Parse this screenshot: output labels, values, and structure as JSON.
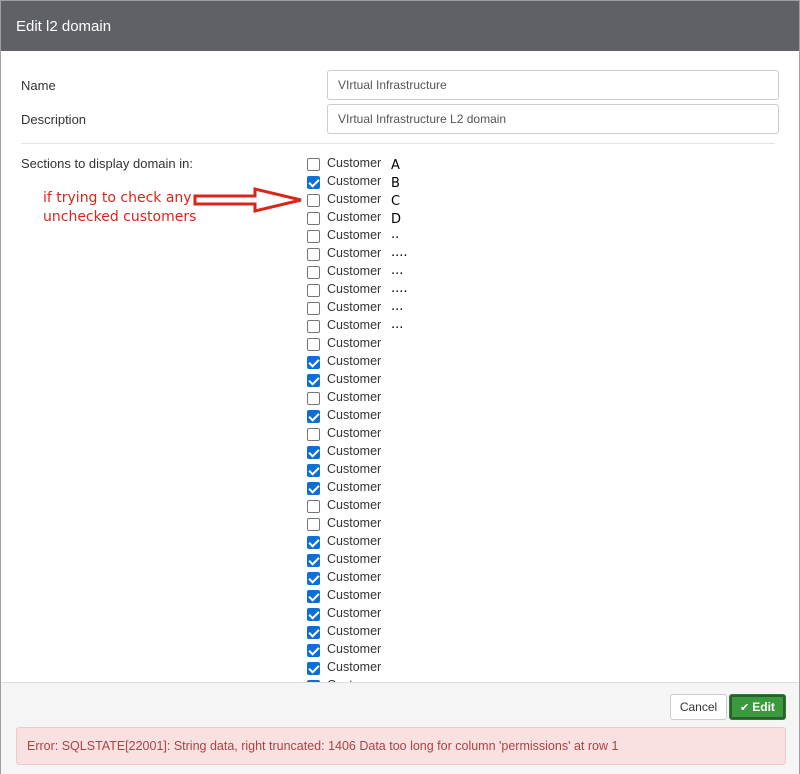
{
  "modal": {
    "title": "Edit l2 domain"
  },
  "form": {
    "name_label": "Name",
    "name_value": "VIrtual Infrastructure",
    "description_label": "Description",
    "description_value": "VIrtual Infrastructure L2 domain",
    "sections_label": "Sections to display domain in:"
  },
  "customers": [
    {
      "label": "Customer",
      "checked": false
    },
    {
      "label": "Customer",
      "checked": true
    },
    {
      "label": "Customer",
      "checked": false
    },
    {
      "label": "Customer",
      "checked": false
    },
    {
      "label": "Customer",
      "checked": false
    },
    {
      "label": "Customer",
      "checked": false
    },
    {
      "label": "Customer",
      "checked": false
    },
    {
      "label": "Customer",
      "checked": false
    },
    {
      "label": "Customer",
      "checked": false
    },
    {
      "label": "Customer",
      "checked": false
    },
    {
      "label": "Customer",
      "checked": false
    },
    {
      "label": "Customer",
      "checked": true
    },
    {
      "label": "Customer",
      "checked": true
    },
    {
      "label": "Customer",
      "checked": false
    },
    {
      "label": "Customer",
      "checked": true
    },
    {
      "label": "Customer",
      "checked": false
    },
    {
      "label": "Customer",
      "checked": true
    },
    {
      "label": "Customer",
      "checked": true
    },
    {
      "label": "Customer",
      "checked": true
    },
    {
      "label": "Customer",
      "checked": false
    },
    {
      "label": "Customer",
      "checked": false
    },
    {
      "label": "Customer",
      "checked": true
    },
    {
      "label": "Customer",
      "checked": true
    },
    {
      "label": "Customer",
      "checked": true
    },
    {
      "label": "Customer",
      "checked": true
    },
    {
      "label": "Customer",
      "checked": true
    },
    {
      "label": "Customer",
      "checked": true
    },
    {
      "label": "Customer",
      "checked": true
    },
    {
      "label": "Customer",
      "checked": true
    },
    {
      "label": "Customer",
      "checked": true
    }
  ],
  "handwritten_suffixes": [
    "A",
    "B",
    "C",
    "D",
    "..",
    "....",
    "...",
    "....",
    "...",
    "..."
  ],
  "annotation": {
    "text": "if trying to check any unchecked customers",
    "color": "#d9261c"
  },
  "footer": {
    "cancel_label": "Cancel",
    "edit_label": "Edit",
    "error_text": "Error: SQLSTATE[22001]: String data, right truncated: 1406 Data too long for column 'permissions' at row 1"
  },
  "colors": {
    "header_bg": "#5f6166",
    "checkbox_checked": "#0b6fd8",
    "edit_button": "#3c9a3e",
    "error_bg": "#f9e1e1",
    "error_text": "#a94442"
  },
  "icons": {
    "edit_button_icon": "check-icon"
  }
}
